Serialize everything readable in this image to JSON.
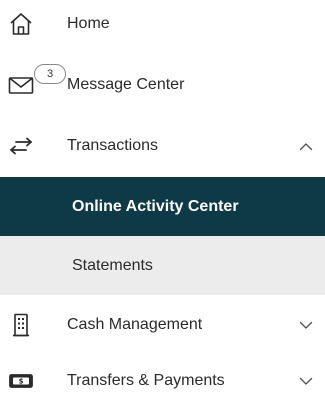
{
  "nav": {
    "home": {
      "label": "Home",
      "icon": "home-icon"
    },
    "messages": {
      "label": "Message Center",
      "icon": "envelope-icon",
      "badge": "3"
    },
    "transactions": {
      "label": "Transactions",
      "icon": "swap-arrows-icon",
      "expanded": true,
      "children": [
        {
          "label": "Online Activity Center",
          "active": true
        },
        {
          "label": "Statements",
          "active": false
        }
      ]
    },
    "cash_management": {
      "label": "Cash Management",
      "icon": "building-icon"
    },
    "transfers_payments": {
      "label": "Transfers & Payments",
      "icon": "dollar-bill-icon"
    }
  },
  "colors": {
    "active_bg": "#0e3a48",
    "sub_bg": "#ececec",
    "text": "#2b2b2b"
  }
}
